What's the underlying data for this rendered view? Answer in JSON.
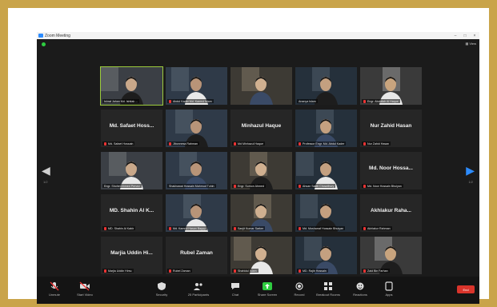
{
  "window": {
    "title": "Zoom Meeting"
  },
  "view_button": "View",
  "paging": {
    "left": "1/2",
    "right": "1/2"
  },
  "tiles": [
    {
      "type": "video",
      "name": "Ishrat Jahan Md. Ishtiak ...",
      "speaking": true,
      "muted": false
    },
    {
      "type": "video",
      "name": "Abdul Kader Md. Kamrul Islam",
      "speaking": false,
      "muted": true
    },
    {
      "type": "video",
      "name": "",
      "speaking": false,
      "muted": false
    },
    {
      "type": "video",
      "name": "Ananya Islam",
      "speaking": false,
      "muted": false
    },
    {
      "type": "video",
      "name": "Engr. Abdullah Al Haque",
      "speaking": false,
      "muted": true
    },
    {
      "type": "name",
      "big": "Md. Safaet Hoss...",
      "name": "Md. Safaet Hossain",
      "muted": true
    },
    {
      "type": "video",
      "name": "Jibonnesa Rahman",
      "speaking": false,
      "muted": true
    },
    {
      "type": "name",
      "big": "Minhazul Haque",
      "name": "Md Minhazul Haque",
      "muted": true
    },
    {
      "type": "video",
      "name": "Professor Engr. Md. Abdul Kader",
      "speaking": false,
      "muted": true
    },
    {
      "type": "name",
      "big": "Nur Zahid Hasan",
      "name": "Nur Zahid Hasan",
      "muted": true
    },
    {
      "type": "video",
      "name": "Engr. Shohel Ahmed Pervez",
      "speaking": false,
      "muted": false
    },
    {
      "type": "video",
      "name": "Shakhawat Hossain Mahmud Tuhin",
      "speaking": false,
      "muted": false
    },
    {
      "type": "video",
      "name": "Engr. Sumon Ahmed",
      "speaking": false,
      "muted": true
    },
    {
      "type": "video",
      "name": "Ahsan Sakib Chowdhury",
      "speaking": false,
      "muted": true
    },
    {
      "type": "name",
      "big": "Md. Noor Hossa...",
      "name": "Md. Noor Hossain Bhuiyan",
      "muted": true
    },
    {
      "type": "name",
      "big": "MD. Shahin Al K...",
      "name": "MD. Shahin Al Kabir",
      "muted": true
    },
    {
      "type": "video",
      "name": "Md. Kamrul Hasan Bappy",
      "speaking": false,
      "muted": true
    },
    {
      "type": "video",
      "name": "Sanjit Kumar Sarker",
      "speaking": false,
      "muted": true
    },
    {
      "type": "video",
      "name": "Md. Mosharraf Hossain Bhuiyan",
      "speaking": false,
      "muted": true
    },
    {
      "type": "name",
      "big": "Akhlakur Raha...",
      "name": "Akhlakur Rahman",
      "muted": true
    },
    {
      "type": "name",
      "big": "Marjia Uddin Hi...",
      "name": "Marjia Uddin Himu",
      "muted": true
    },
    {
      "type": "name",
      "big": "Rubel Zaman",
      "name": "Rubel Zaman",
      "muted": true
    },
    {
      "type": "video",
      "name": "Shahidul Islam",
      "speaking": false,
      "muted": true
    },
    {
      "type": "video",
      "name": "MD. Rajib Hossain",
      "speaking": false,
      "muted": true
    },
    {
      "type": "video",
      "name": "Zaid Bin Farhan",
      "speaking": false,
      "muted": true
    }
  ],
  "toolbar": {
    "unmute": "Unmute",
    "start_video": "Start Video",
    "security": "Security",
    "participants": "Participants",
    "participants_count": "25",
    "chat": "Chat",
    "share_screen": "Share Screen",
    "record": "Record",
    "breakout_rooms": "Breakout Rooms",
    "reactions": "Reactions",
    "apps": "Apps",
    "end": "End"
  },
  "colors": {
    "frame": "#c9a44a",
    "speaking": "#9ccc3c",
    "end": "#d9342b",
    "share": "#2ecc40"
  }
}
